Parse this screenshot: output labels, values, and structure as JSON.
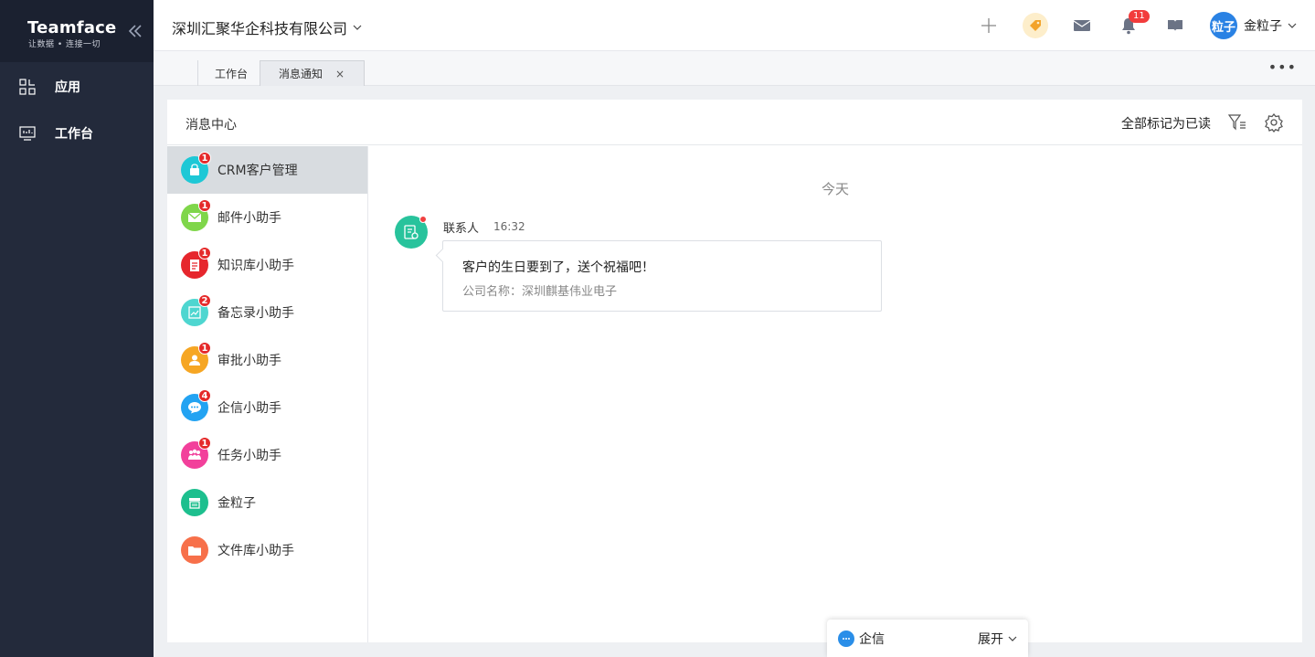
{
  "brand": {
    "name": "Teamface",
    "tagline": "让数据 • 连接一切"
  },
  "sidebar": {
    "items": [
      {
        "label": "应用",
        "icon": "grid-icon"
      },
      {
        "label": "工作台",
        "icon": "monitor-icon"
      }
    ]
  },
  "header": {
    "company": "深圳汇聚华企科技有限公司",
    "notification_count": "11",
    "user": {
      "avatar_text": "粒子",
      "name": "金粒子"
    }
  },
  "tabs": [
    {
      "label": "工作台"
    },
    {
      "label": "消息通知",
      "close": "×"
    }
  ],
  "panel": {
    "title": "消息中心",
    "mark_all_read": "全部标记为已读"
  },
  "channels": [
    {
      "label": "CRM客户管理",
      "badge": "1",
      "color": "#1ec8d6",
      "icon": "crm-icon",
      "active": true
    },
    {
      "label": "邮件小助手",
      "badge": "1",
      "color": "#7fd64a",
      "icon": "mail-icon"
    },
    {
      "label": "知识库小助手",
      "badge": "1",
      "color": "#e6262d",
      "icon": "knowledge-icon"
    },
    {
      "label": "备忘录小助手",
      "badge": "2",
      "color": "#4ed6d0",
      "icon": "memo-icon"
    },
    {
      "label": "审批小助手",
      "badge": "1",
      "color": "#f6a623",
      "icon": "approval-icon"
    },
    {
      "label": "企信小助手",
      "badge": "4",
      "color": "#23a3f2",
      "icon": "chat-icon"
    },
    {
      "label": "任务小助手",
      "badge": "1",
      "color": "#f2409b",
      "icon": "task-icon"
    },
    {
      "label": "金粒子",
      "badge": "",
      "color": "#1dbf8e",
      "icon": "store-icon"
    },
    {
      "label": "文件库小助手",
      "badge": "",
      "color": "#f7704a",
      "icon": "folder-icon"
    }
  ],
  "messages": {
    "day": "今天",
    "items": [
      {
        "sender": "联系人",
        "time": "16:32",
        "title": "客户的生日要到了，送个祝福吧！",
        "subtitle": "公司名称：深圳麒基伟业电子"
      }
    ]
  },
  "chat_widget": {
    "label": "企信",
    "expand": "展开"
  }
}
